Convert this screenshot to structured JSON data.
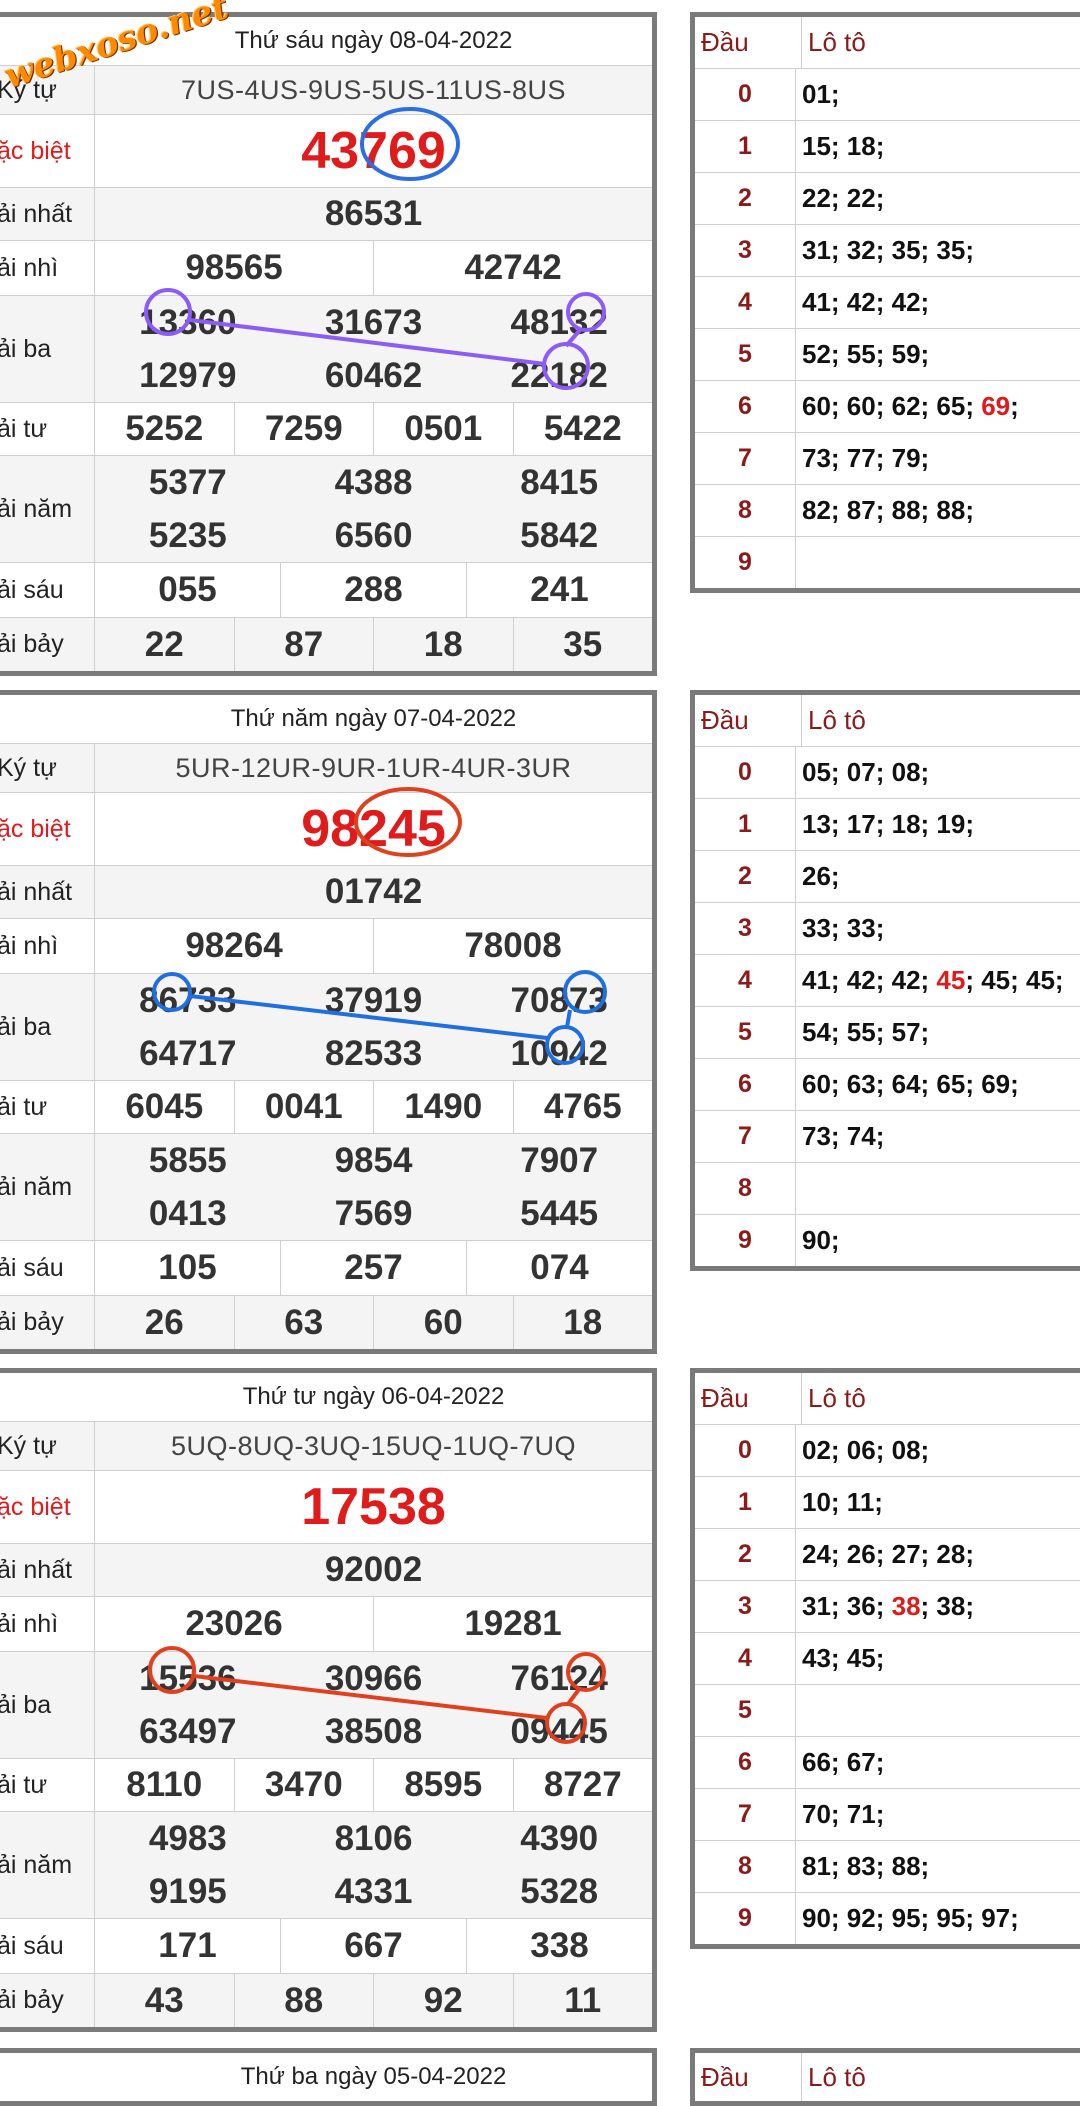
{
  "watermark": "webxoso.net",
  "labels": {
    "kytu": "Ký tự",
    "db": "ặc biệt",
    "g1": "ải nhất",
    "g2": "ải nhì",
    "g3": "ải ba",
    "g4": "ải tư",
    "g5": "ải năm",
    "g6": "ải sáu",
    "g7": "ải bảy"
  },
  "loto_header": {
    "dau": "Đầu",
    "loto": "Lô tô"
  },
  "draws": [
    {
      "date": "Thứ sáu ngày 08-04-2022",
      "kytu_label": "Ký tự",
      "kytu": "7US-4US-9US-5US-11US-8US",
      "db": "43769",
      "g1": [
        "86531"
      ],
      "g2": [
        "98565",
        "42742"
      ],
      "g3": [
        "13360",
        "31673",
        "48132",
        "12979",
        "60462",
        "22182"
      ],
      "g4": [
        "5252",
        "7259",
        "0501",
        "5422"
      ],
      "g5": [
        "5377",
        "4388",
        "8415",
        "5235",
        "6560",
        "5842"
      ],
      "g6": [
        "055",
        "288",
        "241"
      ],
      "g7": [
        "22",
        "87",
        "18",
        "35"
      ],
      "loto": {
        "heads": [
          "0",
          "1",
          "2",
          "3",
          "4",
          "5",
          "6",
          "7",
          "8",
          "9"
        ],
        "rows": [
          {
            "pre": "01;",
            "hl": "",
            "post": ""
          },
          {
            "pre": "15; 18;",
            "hl": "",
            "post": ""
          },
          {
            "pre": "22; 22;",
            "hl": "",
            "post": ""
          },
          {
            "pre": "31; 32; 35; 35;",
            "hl": "",
            "post": ""
          },
          {
            "pre": "41; 42; 42;",
            "hl": "",
            "post": ""
          },
          {
            "pre": "52; 55; 59;",
            "hl": "",
            "post": ""
          },
          {
            "pre": "60; 60; 62; 65; ",
            "hl": "69",
            "post": ";"
          },
          {
            "pre": "73; 77; 79;",
            "hl": "",
            "post": ""
          },
          {
            "pre": "82; 87; 88; 88;",
            "hl": "",
            "post": ""
          },
          {
            "pre": "",
            "hl": "",
            "post": ""
          }
        ]
      },
      "mark_color": "#2e6fe0",
      "link_color": "#8b5cf6"
    },
    {
      "date": "Thứ năm ngày 07-04-2022",
      "kytu_label": "Ký tự",
      "kytu": "5UR-12UR-9UR-1UR-4UR-3UR",
      "db": "98245",
      "g1": [
        "01742"
      ],
      "g2": [
        "98264",
        "78008"
      ],
      "g3": [
        "86733",
        "37919",
        "70873",
        "64717",
        "82533",
        "10942"
      ],
      "g4": [
        "6045",
        "0041",
        "1490",
        "4765"
      ],
      "g5": [
        "5855",
        "9854",
        "7907",
        "0413",
        "7569",
        "5445"
      ],
      "g6": [
        "105",
        "257",
        "074"
      ],
      "g7": [
        "26",
        "63",
        "60",
        "18"
      ],
      "loto": {
        "heads": [
          "0",
          "1",
          "2",
          "3",
          "4",
          "5",
          "6",
          "7",
          "8",
          "9"
        ],
        "rows": [
          {
            "pre": "05; 07; 08;",
            "hl": "",
            "post": ""
          },
          {
            "pre": "13; 17; 18; 19;",
            "hl": "",
            "post": ""
          },
          {
            "pre": "26;",
            "hl": "",
            "post": ""
          },
          {
            "pre": "33; 33;",
            "hl": "",
            "post": ""
          },
          {
            "pre": "41; 42; 42; ",
            "hl": "45",
            "post": "; 45; 45;"
          },
          {
            "pre": "54; 55; 57;",
            "hl": "",
            "post": ""
          },
          {
            "pre": "60; 63; 64; 65; 69;",
            "hl": "",
            "post": ""
          },
          {
            "pre": "73; 74;",
            "hl": "",
            "post": ""
          },
          {
            "pre": "",
            "hl": "",
            "post": ""
          },
          {
            "pre": "90;",
            "hl": "",
            "post": ""
          }
        ]
      },
      "mark_color": "#e0401e",
      "link_color": "#1f6fe0"
    },
    {
      "date": "Thứ tư ngày 06-04-2022",
      "kytu_label": "Ký tự",
      "kytu": "5UQ-8UQ-3UQ-15UQ-1UQ-7UQ",
      "db": "17538",
      "g1": [
        "92002"
      ],
      "g2": [
        "23026",
        "19281"
      ],
      "g3": [
        "15536",
        "30966",
        "76124",
        "63497",
        "38508",
        "09445"
      ],
      "g4": [
        "8110",
        "3470",
        "8595",
        "8727"
      ],
      "g5": [
        "4983",
        "8106",
        "4390",
        "9195",
        "4331",
        "5328"
      ],
      "g6": [
        "171",
        "667",
        "338"
      ],
      "g7": [
        "43",
        "88",
        "92",
        "11"
      ],
      "loto": {
        "heads": [
          "0",
          "1",
          "2",
          "3",
          "4",
          "5",
          "6",
          "7",
          "8",
          "9"
        ],
        "rows": [
          {
            "pre": "02; 06; 08;",
            "hl": "",
            "post": ""
          },
          {
            "pre": "10; 11;",
            "hl": "",
            "post": ""
          },
          {
            "pre": "24; 26; 27; 28;",
            "hl": "",
            "post": ""
          },
          {
            "pre": "31; 36; ",
            "hl": "38",
            "post": "; 38;"
          },
          {
            "pre": "43; 45;",
            "hl": "",
            "post": ""
          },
          {
            "pre": "",
            "hl": "",
            "post": ""
          },
          {
            "pre": "66; 67;",
            "hl": "",
            "post": ""
          },
          {
            "pre": "70; 71;",
            "hl": "",
            "post": ""
          },
          {
            "pre": "81; 83; 88;",
            "hl": "",
            "post": ""
          },
          {
            "pre": "90; 92; 95; 95; 97;",
            "hl": "",
            "post": ""
          }
        ]
      },
      "mark_color": "",
      "link_color": "#e0401e"
    },
    {
      "date": "Thứ ba ngày 05-04-2022"
    }
  ]
}
